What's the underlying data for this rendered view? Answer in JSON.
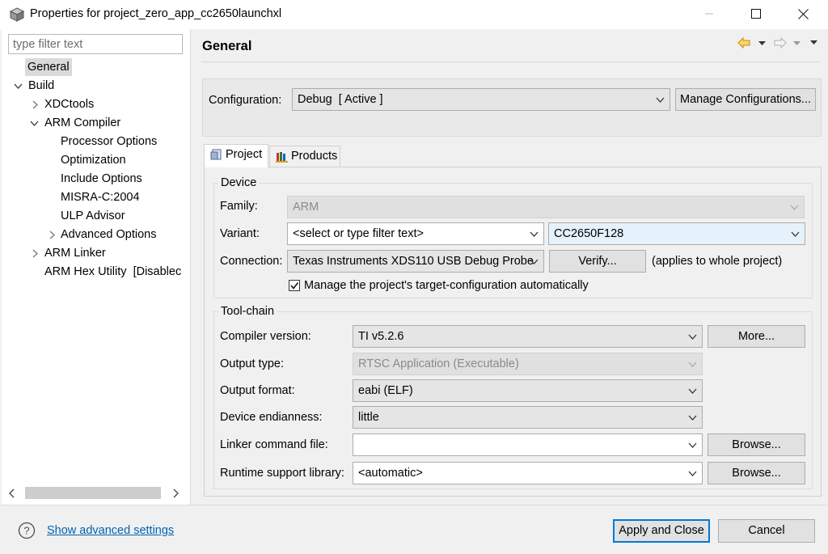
{
  "window": {
    "title": "Properties for project_zero_app_cc2650launchxl"
  },
  "tree": {
    "filter_placeholder": "type filter text",
    "items": [
      {
        "label": "General"
      },
      {
        "label": "Build"
      },
      {
        "label": "XDCtools"
      },
      {
        "label": "ARM Compiler"
      },
      {
        "label": "Processor Options"
      },
      {
        "label": "Optimization"
      },
      {
        "label": "Include Options"
      },
      {
        "label": "MISRA-C:2004"
      },
      {
        "label": "ULP Advisor"
      },
      {
        "label": "Advanced Options"
      },
      {
        "label": "ARM Linker"
      },
      {
        "label": "ARM Hex Utility  [Disablec"
      }
    ]
  },
  "page": {
    "title": "General",
    "configuration": {
      "label": "Configuration:",
      "value": "Debug  [ Active ]",
      "manage_button": "Manage Configurations..."
    },
    "tabs": [
      {
        "label": "Project"
      },
      {
        "label": "Products"
      }
    ],
    "device": {
      "group_title": "Device",
      "family_label": "Family:",
      "family_value": "ARM",
      "variant_label": "Variant:",
      "variant_filter": "<select or type filter text>",
      "variant_value": "CC2650F128",
      "connection_label": "Connection:",
      "connection_value": "Texas Instruments XDS110 USB Debug Probe",
      "verify_button": "Verify...",
      "applies_note": "(applies to whole project)",
      "manage_target_checkbox": "Manage the project's target-configuration automatically",
      "manage_target_checked": true
    },
    "toolchain": {
      "group_title": "Tool-chain",
      "compiler_label": "Compiler version:",
      "compiler_value": "TI v5.2.6",
      "more_button": "More...",
      "output_type_label": "Output type:",
      "output_type_value": "RTSC Application (Executable)",
      "output_format_label": "Output format:",
      "output_format_value": "eabi (ELF)",
      "endianness_label": "Device endianness:",
      "endianness_value": "little",
      "linker_cmd_label": "Linker command file:",
      "linker_cmd_value": "",
      "browse_button": "Browse...",
      "runtime_label": "Runtime support library:",
      "runtime_value": "<automatic>"
    }
  },
  "footer": {
    "advanced_link": "Show advanced settings",
    "apply_button": "Apply and Close",
    "cancel_button": "Cancel"
  },
  "colors": {
    "link": "#0063b1",
    "default_button_border": "#0078d7",
    "nav_back_arrow": "#e8a317"
  }
}
